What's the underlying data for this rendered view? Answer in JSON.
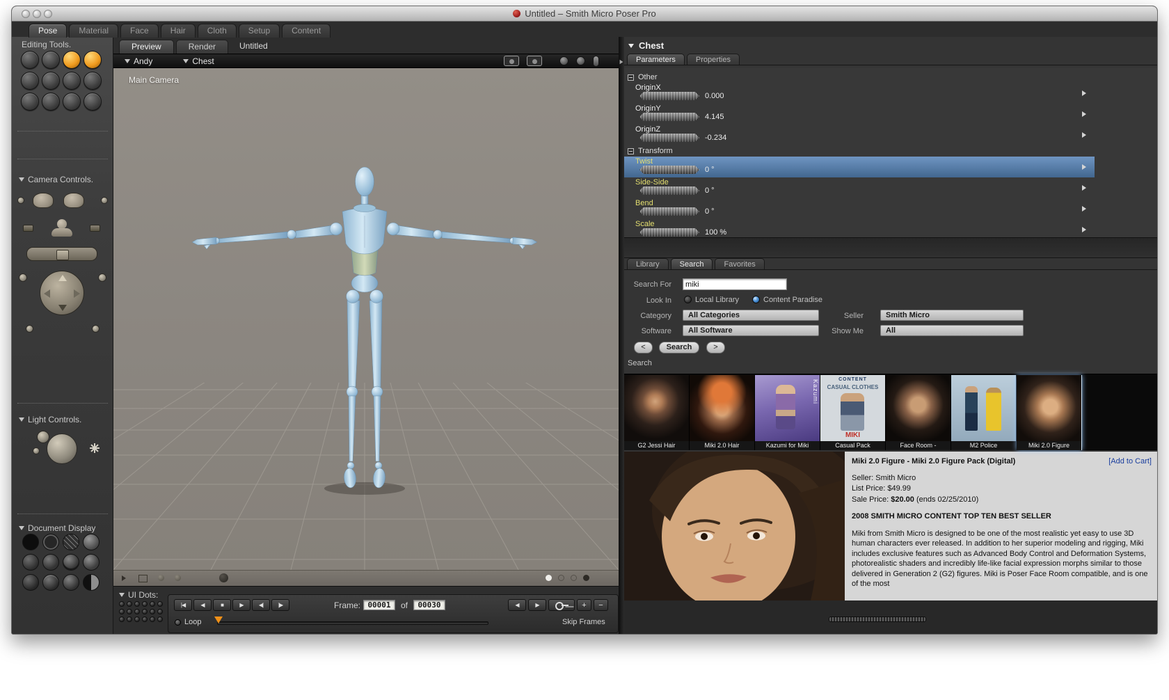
{
  "window": {
    "title": "Untitled – Smith Micro Poser Pro"
  },
  "main_tabs": [
    {
      "label": "Pose"
    },
    {
      "label": "Material"
    },
    {
      "label": "Face"
    },
    {
      "label": "Hair"
    },
    {
      "label": "Cloth"
    },
    {
      "label": "Setup"
    },
    {
      "label": "Content"
    }
  ],
  "sidebar": {
    "editing_tools_label": "Editing Tools.",
    "camera_controls_label": "Camera Controls.",
    "light_controls_label": "Light Controls.",
    "document_display_label": "Document Display"
  },
  "viewport": {
    "tabs": [
      {
        "label": "Preview"
      },
      {
        "label": "Render"
      }
    ],
    "document_title": "Untitled",
    "figure_menu": "Andy",
    "actor_menu": "Chest",
    "camera_label": "Main Camera"
  },
  "timeline": {
    "ui_dots_label": "UI Dots:",
    "frame_label": "Frame:",
    "frame_current": "00001",
    "of_label": "of",
    "frame_total": "00030",
    "loop_label": "Loop",
    "skip_frames_label": "Skip Frames",
    "transport": [
      {
        "name": "first-frame",
        "glyph": "|◀"
      },
      {
        "name": "step-back",
        "glyph": "◀"
      },
      {
        "name": "stop",
        "glyph": "■"
      },
      {
        "name": "play",
        "glyph": "▶"
      },
      {
        "name": "prev-frame",
        "glyph": "◀|"
      },
      {
        "name": "next-frame",
        "glyph": "|▶"
      }
    ],
    "edit_buttons": [
      {
        "name": "prev-keyframe",
        "glyph": "◀"
      },
      {
        "name": "next-keyframe",
        "glyph": "▶"
      },
      {
        "name": "add-keyframe",
        "glyph": "+"
      },
      {
        "name": "delete-keyframe",
        "glyph": "−"
      }
    ]
  },
  "parameters": {
    "actor_name": "Chest",
    "tabs": [
      {
        "label": "Parameters"
      },
      {
        "label": "Properties"
      }
    ],
    "groups": [
      {
        "name": "Other",
        "rows": [
          {
            "label": "OriginX",
            "value": "0.000"
          },
          {
            "label": "OriginY",
            "value": "4.145"
          },
          {
            "label": "OriginZ",
            "value": "-0.234"
          }
        ]
      },
      {
        "name": "Transform",
        "rows": [
          {
            "label": "Twist",
            "value": "0 °"
          },
          {
            "label": "Side-Side",
            "value": "0 °"
          },
          {
            "label": "Bend",
            "value": "0 °"
          },
          {
            "label": "Scale",
            "value": "100 %"
          }
        ]
      }
    ]
  },
  "library": {
    "tabs": [
      {
        "label": "Library"
      },
      {
        "label": "Search"
      },
      {
        "label": "Favorites"
      }
    ],
    "form": {
      "search_for_label": "Search For",
      "search_value": "miki",
      "look_in_label": "Look In",
      "local_library_label": "Local Library",
      "content_paradise_label": "Content Paradise",
      "category_label": "Category",
      "category_value": "All Categories",
      "seller_label": "Seller",
      "seller_value": "Smith Micro",
      "software_label": "Software",
      "software_value": "All Software",
      "show_me_label": "Show Me",
      "show_me_value": "All",
      "prev_button": "<",
      "search_button": "Search",
      "next_button": ">"
    },
    "results_label": "Search",
    "thumbnails": [
      {
        "caption": "G2 Jessi Hair"
      },
      {
        "caption": "Miki 2.0 Hair"
      },
      {
        "caption": "Kazumi for Miki",
        "overlay": "Kazumi"
      },
      {
        "caption": "Casual Pack",
        "overlay_top": "CONTENT",
        "overlay_mid": "CASUAL CLOTHES",
        "overlay_bottom": "MIKI"
      },
      {
        "caption": "Face Room -"
      },
      {
        "caption": "M2 Police"
      },
      {
        "caption": "Miki 2.0 Figure"
      }
    ],
    "product": {
      "title": "Miki 2.0 Figure - Miki 2.0 Figure Pack (Digital)",
      "add_to_cart": "[Add to Cart]",
      "seller_line": "Seller: Smith Micro",
      "list_price_line": "List Price: $49.99",
      "sale_price_prefix": "Sale Price: ",
      "sale_price": "$20.00",
      "sale_price_suffix": " (ends 02/25/2010)",
      "best_seller_line": "2008 SMITH MICRO CONTENT TOP TEN BEST SELLER",
      "description": "Miki from Smith Micro is designed to be one of the most realistic yet easy to use 3D human characters ever released. In addition to her superior modeling and rigging, Miki includes exclusive features such as Advanced Body Control and Deformation Systems, photorealistic shaders and incredibly life-like facial expression morphs similar to those delivered in Generation 2 (G2) figures. Miki is Poser Face Room compatible, and is one of the most"
    }
  },
  "colors": {
    "selected_row": "#4a74a8",
    "tool_highlight": "#ef9a1e",
    "accent_blue": "#4d92d8"
  }
}
